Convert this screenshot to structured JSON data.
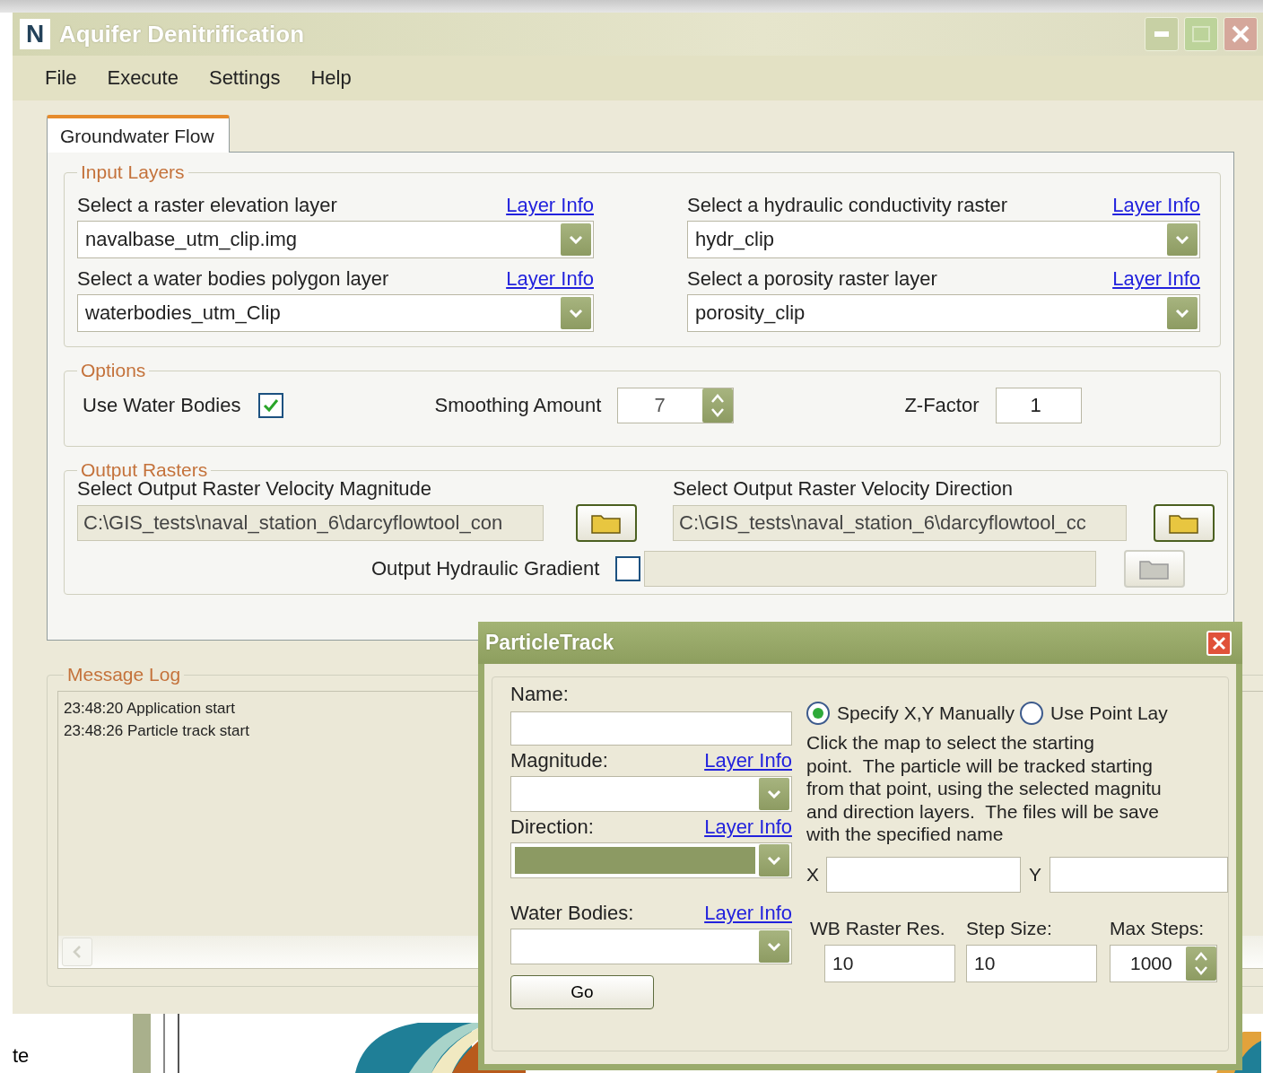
{
  "window": {
    "title": "Aquifer Denitrification",
    "app_icon": "N"
  },
  "menu": [
    "File",
    "Execute",
    "Settings",
    "Help"
  ],
  "tabs": [
    {
      "label": "Groundwater Flow",
      "selected": true
    }
  ],
  "input_layers": {
    "title": "Input Layers",
    "layers": [
      {
        "label": "Select a raster elevation layer",
        "link": "Layer Info",
        "value": "navalbase_utm_clip.img"
      },
      {
        "label": "Select a hydraulic conductivity raster",
        "link": "Layer Info",
        "value": "hydr_clip"
      },
      {
        "label": "Select a water bodies polygon layer",
        "link": "Layer Info",
        "value": "waterbodies_utm_Clip"
      },
      {
        "label": "Select a porosity raster layer",
        "link": "Layer Info",
        "value": "porosity_clip"
      }
    ]
  },
  "options": {
    "title": "Options",
    "use_water_bodies": {
      "label": "Use Water Bodies",
      "checked": true
    },
    "smoothing": {
      "label": "Smoothing Amount",
      "value": "7"
    },
    "z_factor": {
      "label": "Z-Factor",
      "value": "1"
    }
  },
  "output_rasters": {
    "title": "Output Rasters",
    "magnitude": {
      "label": "Select Output Raster Velocity Magnitude",
      "value": "C:\\GIS_tests\\naval_station_6\\darcyflowtool_con"
    },
    "direction": {
      "label": "Select Output Raster Velocity Direction",
      "value": "C:\\GIS_tests\\naval_station_6\\darcyflowtool_cc"
    },
    "gradient": {
      "label": "Output Hydraulic Gradient",
      "checked": false
    }
  },
  "message_log": {
    "title": "Message Log",
    "lines": [
      "23:48:20 Application start",
      "23:48:26 Particle track start"
    ]
  },
  "desktop": {
    "label": "te"
  },
  "particle_dialog": {
    "title": "ParticleTrack",
    "name_label": "Name:",
    "magnitude": {
      "label": "Magnitude:",
      "link": "Layer Info",
      "selected": false
    },
    "direction": {
      "label": "Direction:",
      "link": "Layer Info",
      "selected": true
    },
    "water_bodies": {
      "label": "Water Bodies:",
      "link": "Layer Info",
      "selected": false
    },
    "modes": [
      {
        "label": "Specify X,Y Manually",
        "selected": true
      },
      {
        "label": "Use Point Lay",
        "selected": false
      }
    ],
    "description_lines": [
      "Click the map to select the starting",
      "point.  The particle will be tracked starting",
      "from that point, using the selected magnitu",
      "and direction layers.  The files will be save",
      "with the specified name"
    ],
    "x_label": "X",
    "y_label": "Y",
    "params": [
      {
        "label": "WB Raster Res.",
        "value": "10",
        "kind": "text"
      },
      {
        "label": "Step Size:",
        "value": "10",
        "kind": "text"
      },
      {
        "label": "Max Steps:",
        "value": "1000",
        "kind": "spinner"
      }
    ],
    "go_button": "Go"
  }
}
